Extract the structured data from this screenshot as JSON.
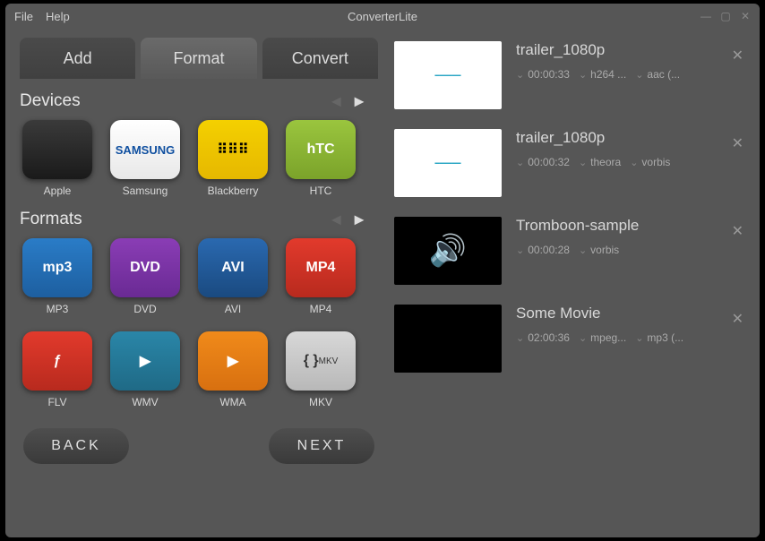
{
  "menu": {
    "file": "File",
    "help": "Help"
  },
  "app_title": "ConverterLite",
  "tabs": {
    "add": "Add",
    "format": "Format",
    "convert": "Convert",
    "active": "format"
  },
  "sections": {
    "devices": "Devices",
    "formats": "Formats"
  },
  "devices": [
    {
      "label": "Apple",
      "color": "t-black",
      "glyph": ""
    },
    {
      "label": "Samsung",
      "color": "t-white",
      "glyph": "SAMSUNG"
    },
    {
      "label": "Blackberry",
      "color": "t-yellow",
      "glyph": "⠿⠿⠿"
    },
    {
      "label": "HTC",
      "color": "t-green",
      "glyph": "hTC"
    }
  ],
  "formats": [
    {
      "label": "MP3",
      "color": "t-blue",
      "glyph": "mp3"
    },
    {
      "label": "DVD",
      "color": "t-purple",
      "glyph": "DVD"
    },
    {
      "label": "AVI",
      "color": "t-darkblue",
      "glyph": "AVI"
    },
    {
      "label": "MP4",
      "color": "t-red",
      "glyph": "MP4"
    },
    {
      "label": "FLV",
      "color": "t-red",
      "glyph": "ƒ"
    },
    {
      "label": "WMV",
      "color": "t-teal",
      "glyph": "▶"
    },
    {
      "label": "WMA",
      "color": "t-orange",
      "glyph": "▶"
    },
    {
      "label": "MKV",
      "color": "t-gray",
      "glyph": "{ }"
    }
  ],
  "nav": {
    "back": "BACK",
    "next": "NEXT"
  },
  "queue": [
    {
      "title": "trailer_1080p",
      "dur": "00:00:33",
      "v": "h264 ...",
      "a": "aac (...",
      "thumb": "white"
    },
    {
      "title": "trailer_1080p",
      "dur": "00:00:32",
      "v": "theora",
      "a": "vorbis",
      "thumb": "white"
    },
    {
      "title": "Tromboon-sample",
      "dur": "00:00:28",
      "v": "",
      "a": "vorbis",
      "thumb": "sound"
    },
    {
      "title": "Some Movie",
      "dur": "02:00:36",
      "v": "mpeg...",
      "a": "mp3 (...",
      "thumb": "black"
    }
  ],
  "colors": {
    "accent": "#1aa0c0"
  }
}
